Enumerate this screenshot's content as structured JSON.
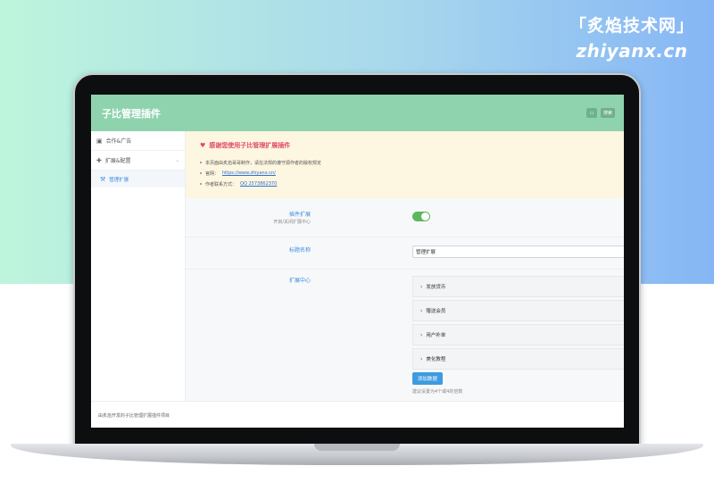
{
  "watermark": {
    "brand_cn": "「炙焰技术网」",
    "brand_en": "zhiyanx.cn"
  },
  "app": {
    "title": "子比管理插件",
    "tool_icon": "window-icon",
    "tool_label": "搜索"
  },
  "sidebar": {
    "items": [
      {
        "label": "合作&广告",
        "icon": "image-icon"
      },
      {
        "label": "扩展&配置",
        "icon": "puzzle-icon",
        "caret": "⌄"
      }
    ],
    "sub_items": [
      {
        "label": "管理扩展",
        "icon": "tools-icon"
      }
    ]
  },
  "notice": {
    "heading": "感谢您使用子比管理扩展插件",
    "lines": [
      {
        "text": "本页面由炙焰哥哥制作，请在法规的遵守源作者的版权规定"
      },
      {
        "prefix": "官网：",
        "link": "https://www.zhiyanx.cn/"
      },
      {
        "prefix": "作者联系方式：",
        "link": "QQ 2573862370"
      }
    ]
  },
  "form": {
    "plugin_ext": {
      "label": "插件扩展",
      "hint": "开启/关闭扩展中心",
      "enabled": true
    },
    "tag_name": {
      "label": "标题名称",
      "value": "管理扩展"
    },
    "ext_center": {
      "label": "扩展中心",
      "items": [
        "发放货币",
        "赠送会员",
        "用户补单",
        "美化教程"
      ],
      "add_button": "添加数据",
      "add_hint": "建议设置为4个或4的倍数"
    }
  },
  "footer": {
    "text": "由炙焰开发的子比管理扩展插件项目"
  },
  "colors": {
    "topbar": "#8fd3ae",
    "accent": "#3a8fe0",
    "notice_bg": "#fdf6e0",
    "heading": "#e04a6a",
    "toggle_on": "#5cb85c"
  }
}
